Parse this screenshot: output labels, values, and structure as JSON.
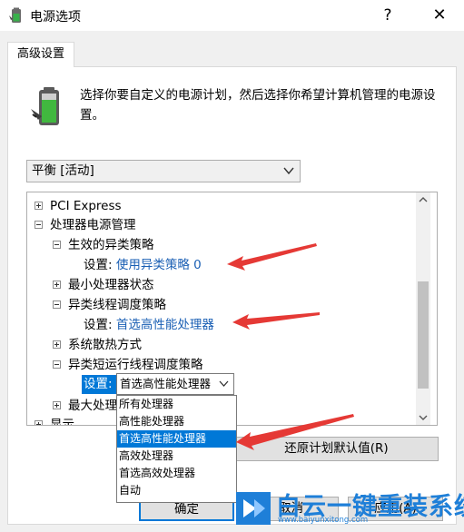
{
  "window": {
    "title": "电源选项",
    "help_label": "?",
    "close_label": "✕"
  },
  "tab": {
    "label": "高级设置"
  },
  "description": "选择你要自定义的电源计划，然后选择你希望计算机管理的电源设置。",
  "plan": {
    "selected": "平衡 [活动]"
  },
  "tree": {
    "items": [
      {
        "label": "PCI Express",
        "state": "collapsed"
      },
      {
        "label": "处理器电源管理",
        "state": "expanded"
      },
      {
        "label": "生效的异类策略",
        "state": "expanded"
      },
      {
        "prefix": "设置:",
        "value": "使用异类策略 0"
      },
      {
        "label": "最小处理器状态",
        "state": "collapsed"
      },
      {
        "label": "异类线程调度策略",
        "state": "expanded"
      },
      {
        "prefix": "设置:",
        "value": "首选高性能处理器"
      },
      {
        "label": "系统散热方式",
        "state": "collapsed"
      },
      {
        "label": "异类短运行线程调度策略",
        "state": "expanded"
      },
      {
        "prefix": "设置:",
        "value": "首选高性能处理器"
      },
      {
        "label": "最大处理器",
        "state": "collapsed"
      },
      {
        "label": "显示",
        "state": "collapsed"
      }
    ]
  },
  "dropdown": {
    "options": [
      "所有处理器",
      "高性能处理器",
      "首选高性能处理器",
      "高效处理器",
      "首选高效处理器",
      "自动"
    ],
    "selected_index": 2
  },
  "buttons": {
    "restore": "还原计划默认值(R)",
    "ok": "确定",
    "cancel": "取消",
    "apply": "应用(A)"
  },
  "watermark": {
    "text": "白云一键重装系统",
    "url": "www.baiyunxitong.com"
  },
  "colors": {
    "accent": "#0078d7",
    "link": "#1a5fb4",
    "annotation_arrow": "#e53935",
    "watermark": "#1e7fd8"
  }
}
